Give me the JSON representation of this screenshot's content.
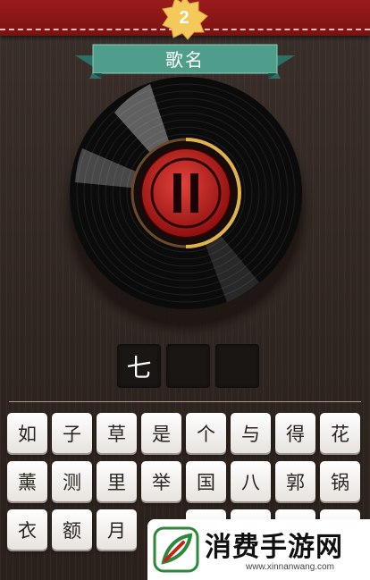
{
  "level": {
    "number": "2"
  },
  "ribbon": {
    "title": "歌名"
  },
  "player": {
    "state": "paused",
    "progress": 0.5,
    "accent_color": "#e2b24a",
    "button_color": "#c8201c"
  },
  "answer_slots": [
    "七",
    "",
    ""
  ],
  "keyboard": {
    "rows": [
      [
        "如",
        "子",
        "草",
        "是",
        "个",
        "与",
        "得",
        "花"
      ],
      [
        "薰",
        "测",
        "里",
        "举",
        "国",
        "八",
        "郭",
        "锅"
      ],
      [
        "衣",
        "额",
        "月",
        "",
        "",
        "",
        "",
        ""
      ]
    ]
  },
  "watermark": {
    "title": "消费手游网",
    "url": "www.xinnanwang.com",
    "icon": "leaf-logo-icon",
    "color": "#2a8a3a"
  }
}
